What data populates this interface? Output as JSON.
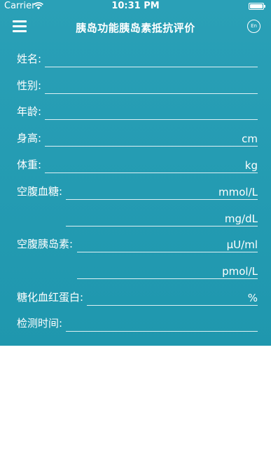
{
  "status_bar": {
    "carrier": "Carrier",
    "time": "10:31 PM"
  },
  "nav": {
    "title": "胰岛功能胰岛素抵抗评价",
    "lang_label": "En"
  },
  "form": {
    "name_label": "姓名:",
    "gender_label": "性别:",
    "age_label": "年龄:",
    "height_label": "身高:",
    "height_unit": "cm",
    "weight_label": "体重:",
    "weight_unit": "kg",
    "fpg_label": "空腹血糖:",
    "fpg_unit_mmol": "mmol/L",
    "fpg_unit_mg": "mg/dL",
    "fins_label": "空腹胰岛素:",
    "fins_unit_uu": "µU/ml",
    "fins_unit_pmol": "pmol/L",
    "hba1c_label": "糖化血红蛋白:",
    "hba1c_unit": "%",
    "test_time_label": "检测时间:"
  },
  "colors": {
    "primary": "#2aa0b7",
    "text": "#ffffff"
  }
}
